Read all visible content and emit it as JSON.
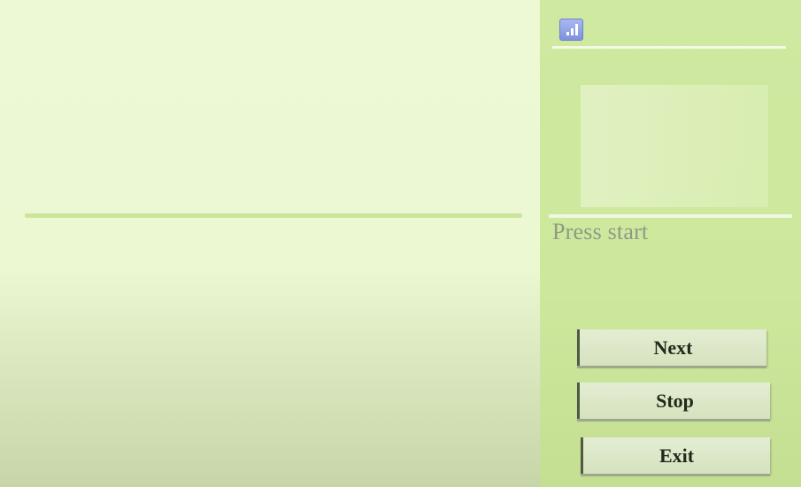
{
  "panel": {
    "icon": "bar-chart-icon",
    "status": "Press start"
  },
  "buttons": {
    "next": "Next",
    "stop": "Stop",
    "exit": "Exit"
  },
  "colors": {
    "main_background": "#edf8d5",
    "side_background": "#cfe9a0",
    "divider": "#cbe69a",
    "button_face": "#e4edd2",
    "status_text": "#8f9a86"
  }
}
